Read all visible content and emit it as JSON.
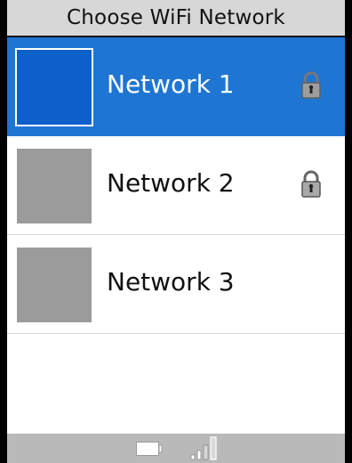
{
  "header": {
    "title": "Choose WiFi Network"
  },
  "networks": [
    {
      "name": "Network 1",
      "selected": true,
      "locked": true
    },
    {
      "name": "Network 2",
      "selected": false,
      "locked": true
    },
    {
      "name": "Network 3",
      "selected": false,
      "locked": false
    }
  ],
  "status": {
    "battery_icon": "battery-icon",
    "signal_icon": "signal-strength-icon",
    "signal_bars": 2,
    "signal_total_bars": 4
  },
  "colors": {
    "selected_row": "#1f75d2",
    "title_bar": "#d7d7d7",
    "status_bar": "#b9b9b9",
    "thumbnail": "#9b9b9b"
  }
}
